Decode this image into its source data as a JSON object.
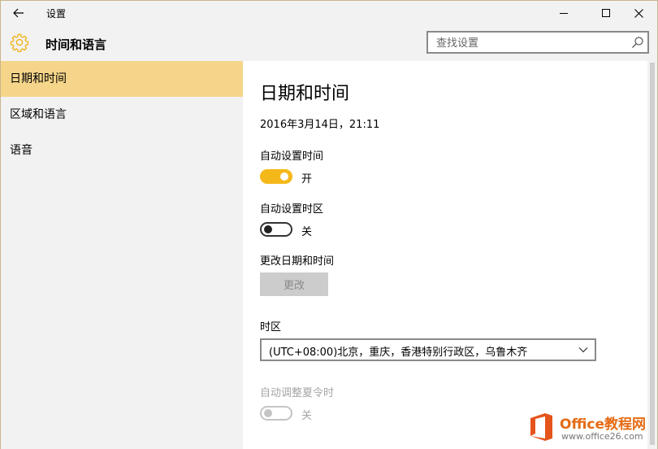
{
  "window": {
    "title": "设置",
    "controls": [
      "minimize",
      "maximize",
      "close"
    ]
  },
  "header": {
    "icon": "gear-icon",
    "title": "时间和语言",
    "search_placeholder": "查找设置"
  },
  "sidebar": {
    "items": [
      {
        "label": "日期和时间",
        "active": true
      },
      {
        "label": "区域和语言",
        "active": false
      },
      {
        "label": "语音",
        "active": false
      }
    ]
  },
  "main": {
    "title": "日期和时间",
    "current_datetime": "2016年3月14日，21:11",
    "auto_time": {
      "label": "自动设置时间",
      "state": "开",
      "on": true
    },
    "auto_timezone": {
      "label": "自动设置时区",
      "state": "关",
      "on": false
    },
    "change_datetime": {
      "label": "更改日期和时间",
      "button_label": "更改",
      "enabled": false
    },
    "timezone": {
      "label": "时区",
      "selected": "(UTC+08:00)北京，重庆，香港特别行政区，乌鲁木齐"
    },
    "dst": {
      "label": "自动调整夏令时",
      "state": "关",
      "enabled": false
    }
  },
  "watermark": {
    "brand": "Office教程网",
    "url": "www.office26.com"
  },
  "colors": {
    "accent": "#f5b81a",
    "active_nav": "#f5d58a",
    "chrome": "#f2f2f2",
    "watermark_orange": "#e56b14"
  }
}
